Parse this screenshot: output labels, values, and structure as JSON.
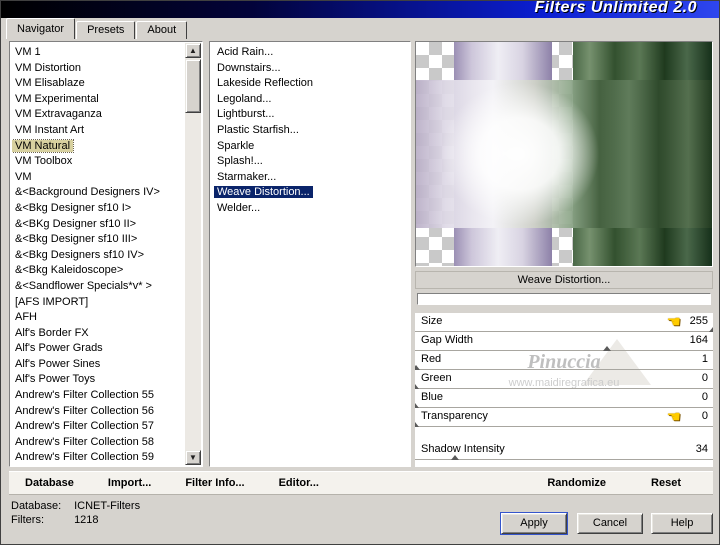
{
  "window": {
    "title": "Filters Unlimited 2.0"
  },
  "tabs": {
    "items": [
      "Navigator",
      "Presets",
      "About"
    ],
    "active": "Navigator"
  },
  "categories": {
    "items": [
      "VM 1",
      "VM Distortion",
      "VM Elisablaze",
      "VM Experimental",
      "VM Extravaganza",
      "VM Instant Art",
      "VM Natural",
      "VM Toolbox",
      "VM",
      "&<Background Designers IV>",
      "&<Bkg Designer sf10 I>",
      "&<BKg Designer sf10 II>",
      "&<Bkg Designer sf10 III>",
      "&<Bkg Designers sf10 IV>",
      "&<Bkg Kaleidoscope>",
      "&<Sandflower Specials*v* >",
      "[AFS IMPORT]",
      "AFH",
      "Alf's Border FX",
      "Alf's Power Grads",
      "Alf's Power Sines",
      "Alf's Power Toys",
      "Andrew's Filter Collection 55",
      "Andrew's Filter Collection 56",
      "Andrew's Filter Collection 57",
      "Andrew's Filter Collection 58",
      "Andrew's Filter Collection 59"
    ],
    "selected": "VM Natural"
  },
  "filters": {
    "items": [
      "Acid Rain...",
      "Downstairs...",
      "Lakeside Reflection",
      "Legoland...",
      "Lightburst...",
      "Plastic Starfish...",
      "Sparkle",
      "Splash!...",
      "Starmaker...",
      "Weave Distortion...",
      "Welder..."
    ],
    "selected": "Weave Distortion..."
  },
  "preview": {
    "filter_label": "Weave Distortion...",
    "progress_value": 0
  },
  "controls": [
    {
      "label": "Size",
      "value": 255,
      "hand": true
    },
    {
      "label": "Gap Width",
      "value": 164
    },
    {
      "label": "Red",
      "value": 1
    },
    {
      "label": "Green",
      "value": 0
    },
    {
      "label": "Blue",
      "value": 0
    },
    {
      "label": "Transparency",
      "value": 0,
      "hand": true
    },
    {
      "label": "Shadow Intensity",
      "value": 34,
      "gap_before": true
    }
  ],
  "watermark": {
    "name": "Pinuccia",
    "url": "www.maidiregrafica.eu"
  },
  "toolbar": {
    "left": [
      "Database",
      "Import...",
      "Filter Info...",
      "Editor..."
    ],
    "right": [
      "Randomize",
      "Reset"
    ]
  },
  "status": {
    "database_label": "Database:",
    "database_value": "ICNET-Filters",
    "filters_label": "Filters:",
    "filters_value": "1218"
  },
  "actions": [
    "Apply",
    "Cancel",
    "Help"
  ],
  "icons": {
    "scroll_up": "▲",
    "scroll_down": "▼",
    "hand": "☚"
  },
  "colors": {
    "selection_blue": "#0a246a",
    "category_highlight": "#d8d1a0",
    "hand_yellow": "#ffcc00",
    "titlebar_blue": "#0b1ed0"
  }
}
